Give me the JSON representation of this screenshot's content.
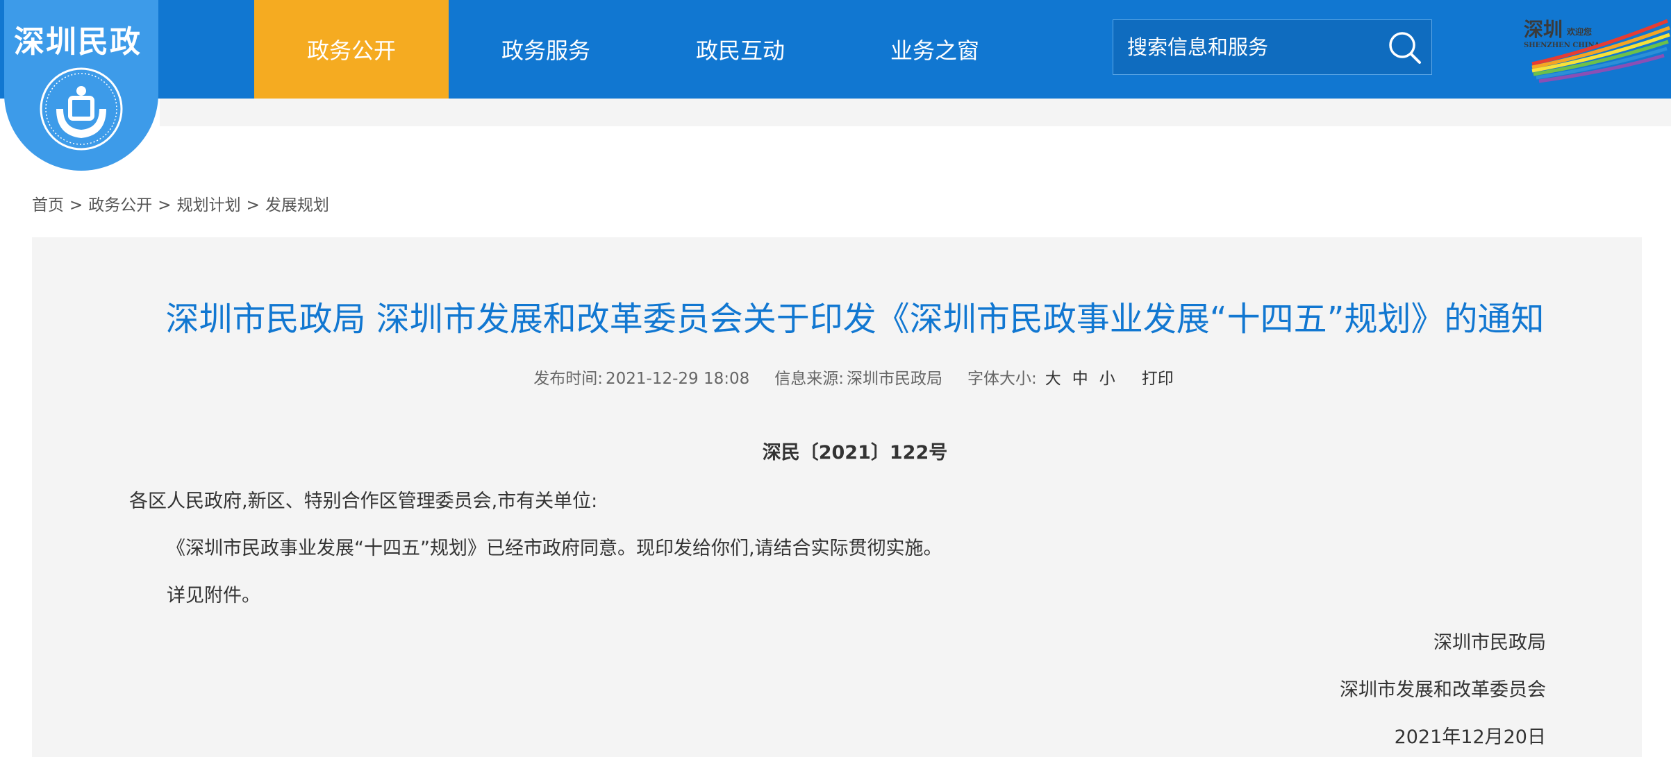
{
  "header": {
    "logo_text": "深圳民政",
    "nav": [
      "政务公开",
      "政务服务",
      "政民互动",
      "业务之窗"
    ],
    "active_nav": 0,
    "search_placeholder": "搜索信息和服务",
    "brand_logo_text": "深圳 SHENZHEN CHINA"
  },
  "breadcrumb": {
    "items": [
      "首页",
      "政务公开",
      "规划计划",
      "发展规划"
    ],
    "separator": ">"
  },
  "article": {
    "title": "深圳市民政局 深圳市发展和改革委员会关于印发《深圳市民政事业发展“十四五”规划》的通知",
    "publish_label": "发布时间:",
    "publish_time": "2021-12-29 18:08",
    "source_label": "信息来源:",
    "source": "深圳市民政局",
    "font_size_label": "字体大小:",
    "font_sizes": [
      "大",
      "中",
      "小"
    ],
    "print_label": "打印",
    "doc_number": "深民〔2021〕122号",
    "salutation": "各区人民政府,新区、特别合作区管理委员会,市有关单位:",
    "body": [
      "《深圳市民政事业发展“十四五”规划》已经市政府同意。现印发给你们,请结合实际贯彻实施。",
      "详见附件。"
    ],
    "signatures": [
      "深圳市民政局",
      "深圳市发展和改革委员会"
    ],
    "date": "2021年12月20日"
  },
  "colors": {
    "header_bg": "#1177d1",
    "active_nav": "#f5ab21",
    "title": "#1177d1",
    "panel_bg": "#f4f4f4"
  }
}
